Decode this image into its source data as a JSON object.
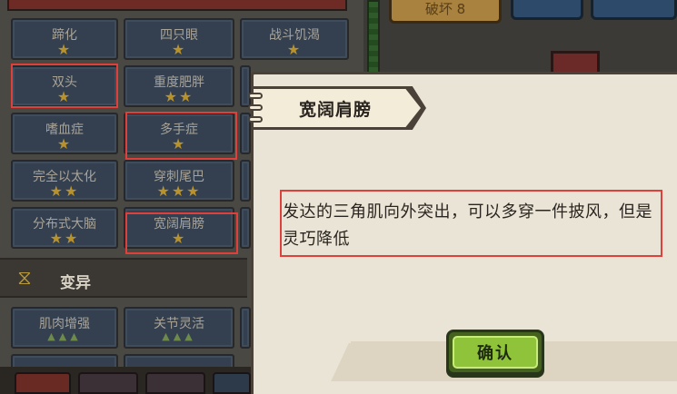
{
  "top": {
    "gold_button_label": "破坏 8"
  },
  "traits": {
    "row1": [
      {
        "label": "蹄化",
        "stars": "★"
      },
      {
        "label": "四只眼",
        "stars": "★"
      },
      {
        "label": "战斗饥渴",
        "stars": "★"
      }
    ],
    "row2": [
      {
        "label": "双头",
        "stars": "★"
      },
      {
        "label": "重度肥胖",
        "stars": "★★"
      }
    ],
    "row3": [
      {
        "label": "嗜血症",
        "stars": "★"
      },
      {
        "label": "多手症",
        "stars": "★"
      }
    ],
    "row4": [
      {
        "label": "完全以太化",
        "stars": "★★"
      },
      {
        "label": "穿刺尾巴",
        "stars": "★★★"
      }
    ],
    "row5": [
      {
        "label": "分布式大脑",
        "stars": "★★"
      },
      {
        "label": "宽阔肩膀",
        "stars": "★"
      }
    ]
  },
  "mutation_section": {
    "title": "变异",
    "icon": "dna-icon",
    "items": [
      {
        "label": "肌肉增强",
        "level": "▲▲▲"
      },
      {
        "label": "关节灵活",
        "level": "▲▲▲"
      }
    ]
  },
  "dialog": {
    "title": "宽阔肩膀",
    "description": "发达的三角肌向外突出，可以多穿一件披风，但是灵巧降低",
    "confirm_label": "确认"
  },
  "colors": {
    "highlight": "#e0403c",
    "star": "#b8922c",
    "confirm_green": "#8fc43a"
  }
}
